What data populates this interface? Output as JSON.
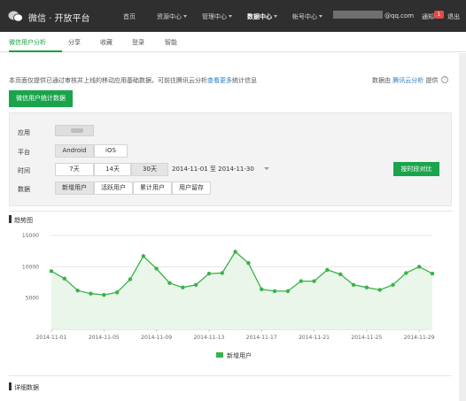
{
  "header": {
    "brand": "微信 · 开放平台",
    "nav": [
      {
        "label": "首页",
        "active": false
      },
      {
        "label": "资源中心",
        "active": false
      },
      {
        "label": "管理中心",
        "active": false
      },
      {
        "label": "数据中心",
        "active": true
      },
      {
        "label": "帐号中心",
        "active": false
      }
    ],
    "email": "@qq.com",
    "notice": "通知",
    "notice_count": "1",
    "logout": "退出"
  },
  "subnav": {
    "tabs": [
      {
        "label": "微信用户分析",
        "active": true
      },
      {
        "label": "分享",
        "active": false
      },
      {
        "label": "收藏",
        "active": false
      },
      {
        "label": "登录",
        "active": false
      },
      {
        "label": "智能",
        "active": false
      }
    ]
  },
  "info": {
    "text": "本页面仅提供已通过审核并上线的移动应用基础数据，可前往腾讯云分析",
    "link": "查看更多",
    "suffix": "统计信息",
    "provider_prefix": "数据由",
    "provider_link": "腾讯云分析",
    "provider_suffix": "提供",
    "help": "?"
  },
  "stats_button": "微信用户统计数据",
  "filters": {
    "app_label": "应用",
    "platform_label": "平台",
    "platform_options": [
      {
        "label": "Android",
        "selected": true
      },
      {
        "label": "iOS",
        "selected": false
      }
    ],
    "time_label": "时间",
    "time_options": [
      {
        "label": "7天",
        "selected": false
      },
      {
        "label": "14天",
        "selected": false
      },
      {
        "label": "30天",
        "selected": true
      }
    ],
    "date_range": "2014-11-01 至 2014-11-30",
    "data_label": "数据",
    "data_options": [
      {
        "label": "新增用户",
        "selected": true
      },
      {
        "label": "活跃用户",
        "selected": false
      },
      {
        "label": "累计用户",
        "selected": false
      },
      {
        "label": "用户留存",
        "selected": false
      }
    ],
    "compare_button": "按时段对比"
  },
  "trend_title": "趋势图",
  "detail_title": "详细数据",
  "colors": {
    "accent": "#1aa44b",
    "line": "#39b24a",
    "area": "#eaf6ea",
    "topbar": "#2f2f2f",
    "link": "#2a7bc0"
  },
  "chart_data": {
    "type": "area",
    "title": "",
    "xlabel": "",
    "ylabel": "",
    "ylim": [
      0,
      15000
    ],
    "yticks": [
      5000,
      10000,
      15000
    ],
    "grid": true,
    "legend": "bottom-center",
    "x": [
      "2014-11-01",
      "2014-11-02",
      "2014-11-03",
      "2014-11-04",
      "2014-11-05",
      "2014-11-06",
      "2014-11-07",
      "2014-11-08",
      "2014-11-09",
      "2014-11-10",
      "2014-11-11",
      "2014-11-12",
      "2014-11-13",
      "2014-11-14",
      "2014-11-15",
      "2014-11-16",
      "2014-11-17",
      "2014-11-18",
      "2014-11-19",
      "2014-11-20",
      "2014-11-21",
      "2014-11-22",
      "2014-11-23",
      "2014-11-24",
      "2014-11-25",
      "2014-11-26",
      "2014-11-27",
      "2014-11-28",
      "2014-11-29",
      "2014-11-30"
    ],
    "xtick_labels": [
      "2014-11-01",
      "2014-11-05",
      "2014-11-09",
      "2014-11-13",
      "2014-11-17",
      "2014-11-21",
      "2014-11-25",
      "2014-11-29"
    ],
    "series": [
      {
        "name": "新增用户",
        "values": [
          9300,
          8100,
          6200,
          5700,
          5500,
          5900,
          8000,
          11700,
          9700,
          7400,
          6700,
          7100,
          8900,
          9000,
          12400,
          10600,
          6400,
          6100,
          6100,
          7700,
          7700,
          9500,
          8800,
          7100,
          6700,
          6300,
          7100,
          9000,
          10000,
          8900
        ]
      }
    ]
  }
}
